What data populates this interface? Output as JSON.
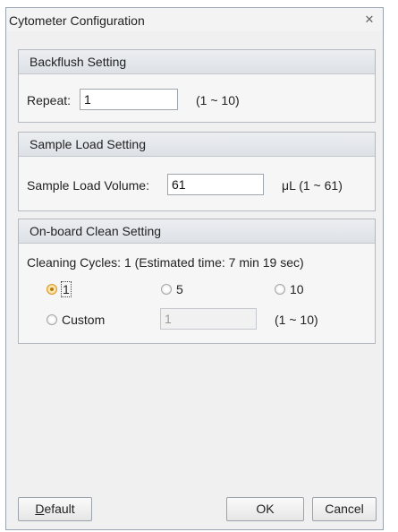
{
  "window": {
    "title": "Cytometer Configuration",
    "close_glyph": "✕"
  },
  "backflush": {
    "header": "Backflush Setting",
    "repeat_label": "Repeat:",
    "repeat_value": "1",
    "range": "(1 ~ 10)"
  },
  "sample_load": {
    "header": "Sample Load Setting",
    "volume_label": "Sample Load Volume:",
    "volume_value": "61",
    "range": "μL (1 ~ 61)"
  },
  "onboard_clean": {
    "header": "On-board Clean Setting",
    "cycles_text": "Cleaning Cycles: 1 (Estimated time: 7 min 19 sec)",
    "options": [
      "1",
      "5",
      "10"
    ],
    "selected": "1",
    "custom_label": "Custom",
    "custom_value": "1",
    "custom_range": "(1 ~ 10)"
  },
  "buttons": {
    "default_first": "D",
    "default_rest": "efault",
    "ok": "OK",
    "cancel": "Cancel"
  }
}
